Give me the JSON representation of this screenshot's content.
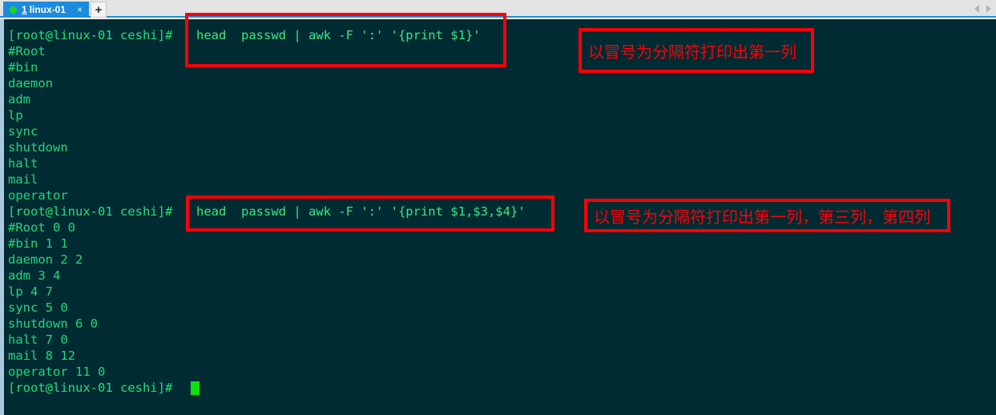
{
  "window": {
    "tab": {
      "index": "1",
      "title": "linux-01",
      "close_label": "×",
      "status_color": "#1ed61e"
    },
    "new_tab_label": "+",
    "scroll_left_icon": "chevron-left-icon",
    "scroll_right_icon": "chevron-right-icon"
  },
  "terminal": {
    "background_color": "#002b33",
    "text_color": "#21e07a",
    "prompt": "[root@linux-01 ceshi]#",
    "block1": {
      "command": "head  passwd | awk -F ':' '{print $1}'",
      "output": [
        "#Root",
        "#bin",
        "daemon",
        "adm",
        "lp",
        "sync",
        "shutdown",
        "halt",
        "mail",
        "operator"
      ]
    },
    "block2": {
      "command": "head  passwd | awk -F ':' '{print $1,$3,$4}'",
      "output": [
        "#Root 0 0",
        "#bin 1 1",
        "daemon 2 2",
        "adm 3 4",
        "lp 4 7",
        "sync 5 0",
        "shutdown 6 0",
        "halt 7 0",
        "mail 8 12",
        "operator 11 0"
      ]
    },
    "final_prompt": "[root@linux-01 ceshi]#",
    "cursor": "block-cursor"
  },
  "annotations": {
    "accent_color": "#fb0007",
    "note1": "以冒号为分隔符打印出第一列",
    "note2": "以冒号为分隔符打印出第一列，第三列，第四列"
  }
}
